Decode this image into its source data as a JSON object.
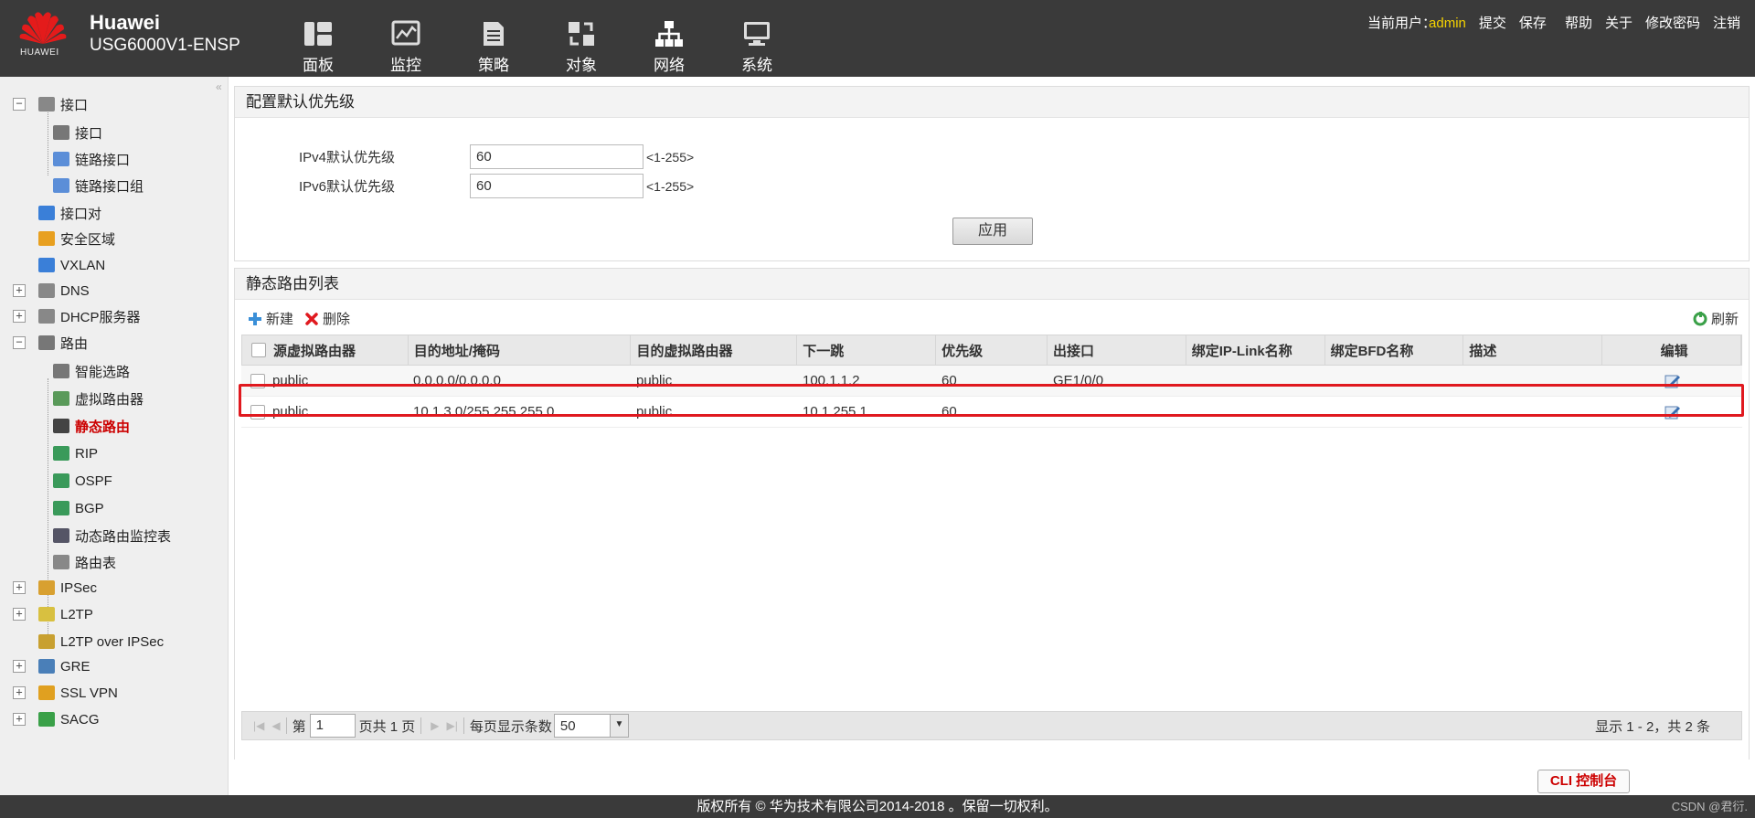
{
  "header": {
    "logo_text": "HUAWEI",
    "brand_line1": "Huawei",
    "brand_line2": "USG6000V1-ENSP",
    "nav": [
      {
        "label": "面板",
        "icon": "dashboard-icon"
      },
      {
        "label": "监控",
        "icon": "monitor-icon"
      },
      {
        "label": "策略",
        "icon": "policy-icon"
      },
      {
        "label": "对象",
        "icon": "object-icon"
      },
      {
        "label": "网络",
        "icon": "network-icon",
        "active": true
      },
      {
        "label": "系统",
        "icon": "system-icon"
      }
    ],
    "user_label": "当前用户：",
    "user_name": "admin",
    "links": [
      "提交",
      "保存",
      "帮助",
      "关于",
      "修改密码",
      "注销"
    ]
  },
  "sidebar": {
    "items": [
      {
        "label": "接口",
        "toggle": "−"
      },
      {
        "label": "接口"
      },
      {
        "label": "链路接口"
      },
      {
        "label": "链路接口组"
      },
      {
        "label": "接口对"
      },
      {
        "label": "安全区域"
      },
      {
        "label": "VXLAN"
      },
      {
        "label": "DNS",
        "toggle": "+"
      },
      {
        "label": "DHCP服务器",
        "toggle": "+"
      },
      {
        "label": "路由",
        "toggle": "−"
      },
      {
        "label": "智能选路"
      },
      {
        "label": "虚拟路由器"
      },
      {
        "label": "静态路由",
        "active": true
      },
      {
        "label": "RIP"
      },
      {
        "label": "OSPF"
      },
      {
        "label": "BGP"
      },
      {
        "label": "动态路由监控表"
      },
      {
        "label": "路由表"
      },
      {
        "label": "IPSec",
        "toggle": "+"
      },
      {
        "label": "L2TP",
        "toggle": "+"
      },
      {
        "label": "L2TP over IPSec"
      },
      {
        "label": "GRE",
        "toggle": "+"
      },
      {
        "label": "SSL VPN",
        "toggle": "+"
      },
      {
        "label": "SACG",
        "toggle": "+"
      }
    ]
  },
  "priority_panel": {
    "title": "配置默认优先级",
    "ipv4_label": "IPv4默认优先级",
    "ipv4_value": "60",
    "ipv6_label": "IPv6默认优先级",
    "ipv6_value": "60",
    "range_hint": "<1-255>",
    "apply_label": "应用"
  },
  "route_panel": {
    "title": "静态路由列表",
    "new_label": "新建",
    "delete_label": "删除",
    "refresh_label": "刷新",
    "columns": [
      "源虚拟路由器",
      "目的地址/掩码",
      "目的虚拟路由器",
      "下一跳",
      "优先级",
      "出接口",
      "绑定IP-Link名称",
      "绑定BFD名称",
      "描述",
      "编辑"
    ],
    "rows": [
      [
        "public",
        "0.0.0.0/0.0.0.0",
        "public",
        "100.1.1.2",
        "60",
        "GE1/0/0",
        "",
        "",
        ""
      ],
      [
        "public",
        "10.1.3.0/255.255.255.0",
        "public",
        "10.1.255.1",
        "60",
        "",
        "",
        "",
        ""
      ]
    ],
    "pager": {
      "page_prefix": "第",
      "page_value": "1",
      "page_suffix": "页共 1 页",
      "per_page_label": "每页显示条数",
      "per_page_value": "50",
      "total": "显示 1 - 2，共 2 条"
    }
  },
  "cli_label": "CLI 控制台",
  "footer": {
    "copyright": "版权所有 © 华为技术有限公司2014-2018 。保留一切权利。",
    "watermark": "CSDN @君衍."
  },
  "colors": {
    "header_bg": "#3a3a3a",
    "accent_red": "#e0191f",
    "user_yellow": "#f5d300"
  }
}
